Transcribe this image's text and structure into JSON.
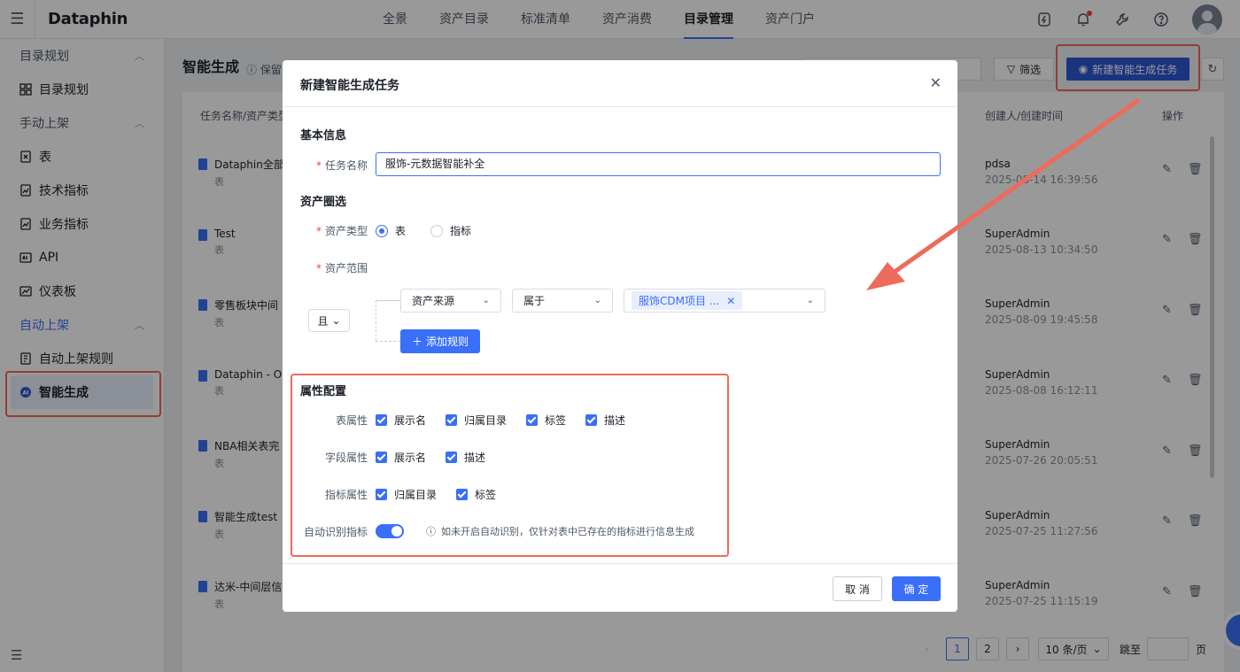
{
  "header": {
    "logo": "Dataphin",
    "nav": [
      "全景",
      "资产目录",
      "标准清单",
      "资产消费",
      "目录管理",
      "资产门户"
    ],
    "active_nav": "目录管理"
  },
  "sidebar": {
    "groups": [
      {
        "label": "目录规划",
        "items": [
          "目录规划"
        ]
      },
      {
        "label": "手动上架",
        "items": [
          "表",
          "技术指标",
          "业务指标",
          "API",
          "仪表板"
        ]
      },
      {
        "label": "自动上架",
        "items": [
          "自动上架规则",
          "智能生成"
        ]
      }
    ],
    "active_item": "智能生成"
  },
  "main": {
    "title": "智能生成",
    "hint": "保留",
    "filter_label": "筛选",
    "new_task_label": "新建智能生成任务",
    "columns": {
      "name": "任务名称/资产类型",
      "creator": "创建人/创建时间",
      "ops": "操作"
    },
    "rows": [
      {
        "name": "Dataphin全部",
        "type": "表",
        "creator": "pdsa",
        "time": "2025-08-14 16:39:56"
      },
      {
        "name": "Test",
        "type": "表",
        "creator": "SuperAdmin",
        "time": "2025-08-13 10:34:50"
      },
      {
        "name": "零售板块中间",
        "type": "表",
        "creator": "SuperAdmin",
        "time": "2025-08-09 19:45:58"
      },
      {
        "name": "Dataphin - OD",
        "type": "表",
        "creator": "SuperAdmin",
        "time": "2025-08-08 16:12:11"
      },
      {
        "name": "NBA相关表完",
        "type": "表",
        "creator": "SuperAdmin",
        "time": "2025-07-26 20:05:51"
      },
      {
        "name": "智能生成test",
        "type": "表",
        "creator": "SuperAdmin",
        "time": "2025-07-25 11:27:56"
      },
      {
        "name": "达米-中间层信",
        "type": "表",
        "creator": "SuperAdmin",
        "time": "2025-07-25 11:15:19"
      }
    ],
    "pagination": {
      "page1": "1",
      "page2": "2",
      "page_size": "10 条/页",
      "jump_label": "跳至",
      "page_unit": "页"
    }
  },
  "modal": {
    "title": "新建智能生成任务",
    "basic_section": "基本信息",
    "task_name_label": "任务名称",
    "task_name_value": "服饰-元数据智能补全",
    "asset_section": "资产圈选",
    "asset_type_label": "资产类型",
    "asset_type_options": [
      "表",
      "指标"
    ],
    "asset_type_selected": "表",
    "asset_scope_label": "资产范围",
    "logic_op": "且",
    "rule_field": "资产来源",
    "rule_op": "属于",
    "rule_value_tag": "服饰CDM项目 ...",
    "add_rule_label": "添加规则",
    "attr_section": "属性配置",
    "table_attr_label": "表属性",
    "table_attrs": [
      "展示名",
      "归属目录",
      "标签",
      "描述"
    ],
    "field_attr_label": "字段属性",
    "field_attrs": [
      "展示名",
      "描述"
    ],
    "metric_attr_label": "指标属性",
    "metric_attrs": [
      "归属目录",
      "标签"
    ],
    "auto_detect_label": "自动识别指标",
    "auto_detect_on": true,
    "auto_detect_hint": "如未开启自动识别，仅针对表中已存在的指标进行信息生成",
    "cancel_label": "取 消",
    "ok_label": "确 定"
  },
  "colors": {
    "accent": "#3a6ff7",
    "highlight": "#ee6a5a"
  }
}
